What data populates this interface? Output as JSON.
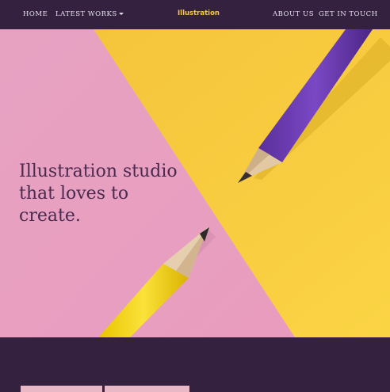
{
  "nav": {
    "home": "HOME",
    "latest_works": "LATEST WORKS",
    "brand": "Illustration",
    "about": "ABOUT US",
    "contact": "GET IN TOUCH"
  },
  "hero": {
    "title_lines": [
      "Illustration studio",
      "that loves to",
      "create."
    ]
  },
  "colors": {
    "nav_bg": "#33213f",
    "brand": "#f7c64a",
    "pink": "#e8a0c0",
    "yellow": "#f6c53c",
    "title": "#4a2a4f"
  },
  "icons": {
    "latest_works_dropdown": "caret-down-icon"
  }
}
